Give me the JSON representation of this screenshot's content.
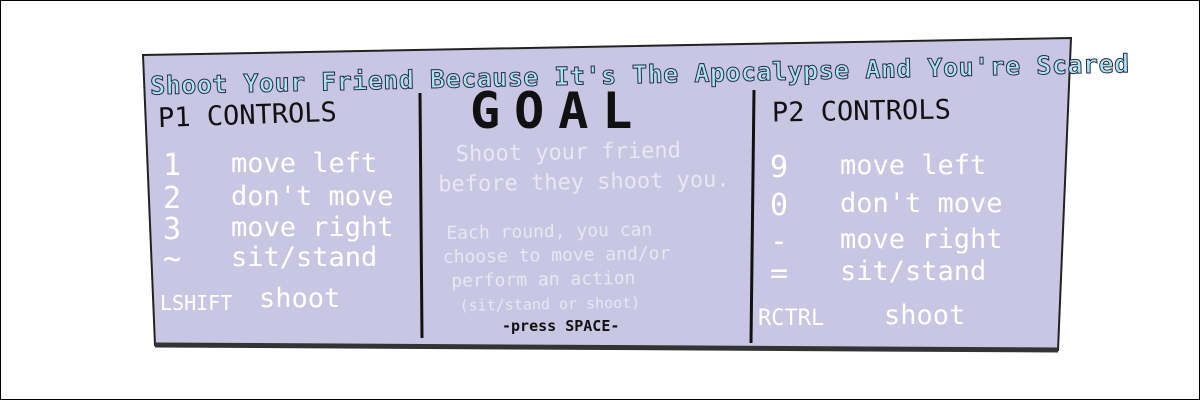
{
  "title": "Shoot Your Friend Because It's The Apocalypse And You're Scared",
  "p1": {
    "heading": "P1 CONTROLS",
    "controls": [
      {
        "key": "1",
        "action": "move left"
      },
      {
        "key": "2",
        "action": "don't move"
      },
      {
        "key": "3",
        "action": "move right"
      },
      {
        "key": "~",
        "action": "sit/stand"
      },
      {
        "key": "LSHIFT",
        "action": "shoot"
      }
    ]
  },
  "goal": {
    "heading": "GOAL",
    "line1": "Shoot your friend",
    "line2": "before they shoot you.",
    "desc1": "Each round, you can",
    "desc2": "choose to move and/or",
    "desc3": "perform an action",
    "desc4": "(sit/stand or shoot)",
    "press": "-press SPACE-"
  },
  "p2": {
    "heading": "P2 CONTROLS",
    "controls": [
      {
        "key": "9",
        "action": "move left"
      },
      {
        "key": "0",
        "action": "don't move"
      },
      {
        "key": "-",
        "action": "move right"
      },
      {
        "key": "=",
        "action": "sit/stand"
      },
      {
        "key": "RCTRL",
        "action": "shoot"
      }
    ]
  },
  "colors": {
    "panel": "#c8c6e3",
    "title": "#a9e6f0",
    "text": "#ffffff",
    "ink": "#111111"
  }
}
